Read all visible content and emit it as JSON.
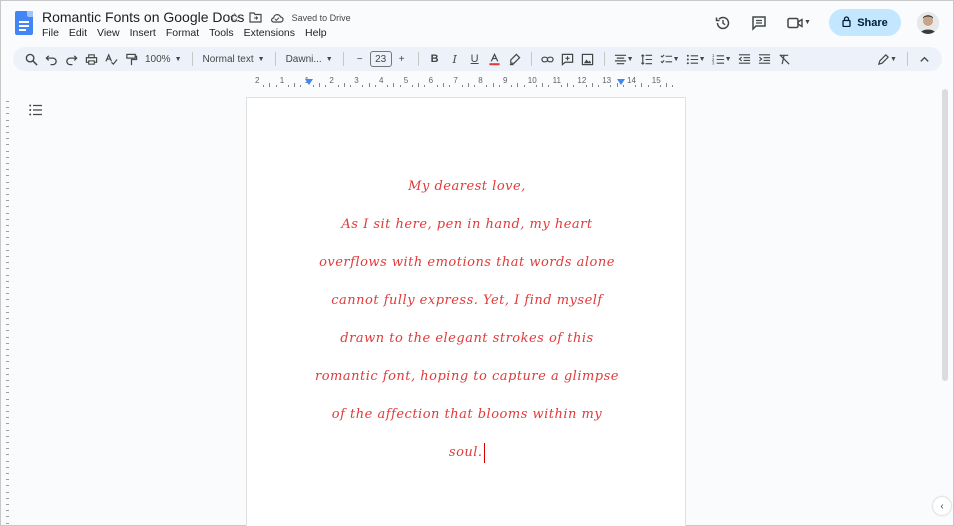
{
  "header": {
    "title": "Romantic Fonts on Google Docs",
    "saved_status": "Saved to Drive",
    "share_label": "Share"
  },
  "menu": [
    "File",
    "Edit",
    "View",
    "Insert",
    "Format",
    "Tools",
    "Extensions",
    "Help"
  ],
  "toolbar": {
    "zoom": "100%",
    "style": "Normal text",
    "font": "Dawni...",
    "font_size": "23"
  },
  "ruler": {
    "labels": [
      "2",
      "1",
      "1",
      "2",
      "3",
      "4",
      "5",
      "6",
      "7",
      "8",
      "9",
      "10",
      "11",
      "12",
      "13",
      "14",
      "15"
    ]
  },
  "document": {
    "lines": [
      "My dearest love,",
      "As I sit here, pen in hand, my heart",
      "overflows with emotions that words alone",
      "cannot fully express. Yet, I find myself",
      "drawn to the elegant strokes of this",
      "romantic font, hoping to capture a glimpse",
      "of the affection that blooms within my",
      "soul."
    ]
  },
  "colors": {
    "text_red": "#e03a3a",
    "share_bg": "#c2e7ff",
    "doc_blue": "#4285f4"
  }
}
